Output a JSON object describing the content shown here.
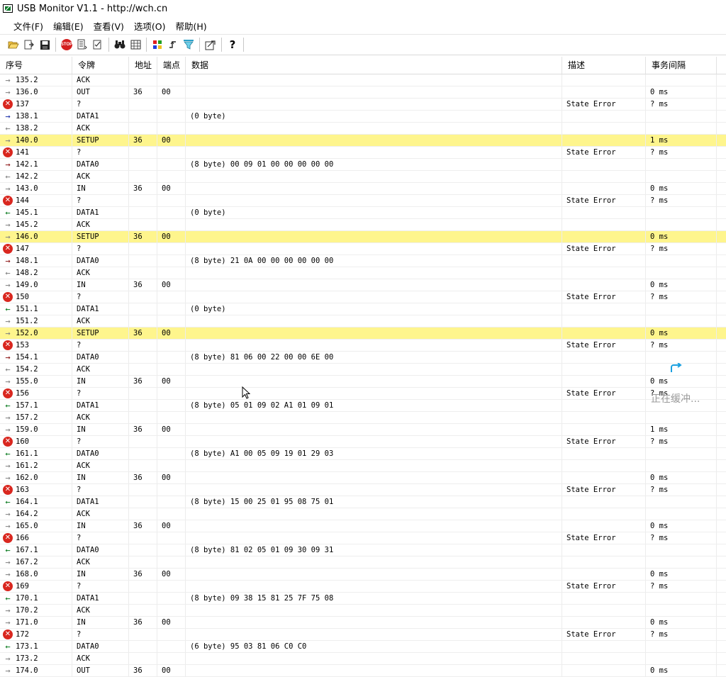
{
  "window": {
    "title": "USB Monitor V1.1 - http://wch.cn"
  },
  "menu": [
    "文件(F)",
    "编辑(E)",
    "查看(V)",
    "选项(O)",
    "帮助(H)"
  ],
  "toolbar": {
    "icons": [
      "open-folder-icon",
      "export-icon",
      "save-icon",
      "stop-icon",
      "filter-icon",
      "checklist-icon",
      "binoculars-find-icon",
      "grid-icon",
      "colors-icon",
      "trigger-icon",
      "funnel-icon",
      "settings-icon",
      "help-icon"
    ],
    "stop_text": "STOP",
    "help_text": "?"
  },
  "columns": [
    "序号",
    "令牌",
    "地址",
    "端点",
    "数据",
    "描述",
    "事务间隔"
  ],
  "rows": [
    {
      "seq": "135.2",
      "dir": "out",
      "token": "ACK",
      "addr": "",
      "ep": "",
      "data": "",
      "desc": "",
      "interval": ""
    },
    {
      "seq": "136.0",
      "dir": "out",
      "token": "OUT",
      "addr": "36",
      "ep": "00",
      "data": "",
      "desc": "",
      "interval": "0 ms"
    },
    {
      "seq": "137",
      "dir": "err",
      "token": "?",
      "addr": "",
      "ep": "",
      "data": "",
      "desc": "State Error",
      "interval": "? ms"
    },
    {
      "seq": "138.1",
      "dir": "host",
      "token": "DATA1",
      "addr": "",
      "ep": "",
      "data": "(0 byte)",
      "desc": "",
      "interval": ""
    },
    {
      "seq": "138.2",
      "dir": "in",
      "token": "ACK",
      "addr": "",
      "ep": "",
      "data": "",
      "desc": "",
      "interval": ""
    },
    {
      "seq": "140.0",
      "dir": "out",
      "token": "SETUP",
      "addr": "36",
      "ep": "00",
      "data": "",
      "desc": "",
      "interval": "1 ms",
      "hl": true
    },
    {
      "seq": "141",
      "dir": "err",
      "token": "?",
      "addr": "",
      "ep": "",
      "data": "",
      "desc": "State Error",
      "interval": "? ms"
    },
    {
      "seq": "142.1",
      "dir": "setup",
      "token": "DATA0",
      "addr": "",
      "ep": "",
      "data": "(8 byte) 00 09 01 00 00 00 00 00",
      "desc": "",
      "interval": ""
    },
    {
      "seq": "142.2",
      "dir": "in",
      "token": "ACK",
      "addr": "",
      "ep": "",
      "data": "",
      "desc": "",
      "interval": ""
    },
    {
      "seq": "143.0",
      "dir": "out",
      "token": "IN",
      "addr": "36",
      "ep": "00",
      "data": "",
      "desc": "",
      "interval": "0 ms"
    },
    {
      "seq": "144",
      "dir": "err",
      "token": "?",
      "addr": "",
      "ep": "",
      "data": "",
      "desc": "State Error",
      "interval": "? ms"
    },
    {
      "seq": "145.1",
      "dir": "dev",
      "token": "DATA1",
      "addr": "",
      "ep": "",
      "data": "(0 byte)",
      "desc": "",
      "interval": ""
    },
    {
      "seq": "145.2",
      "dir": "out",
      "token": "ACK",
      "addr": "",
      "ep": "",
      "data": "",
      "desc": "",
      "interval": ""
    },
    {
      "seq": "146.0",
      "dir": "out",
      "token": "SETUP",
      "addr": "36",
      "ep": "00",
      "data": "",
      "desc": "",
      "interval": "0 ms",
      "hl": true
    },
    {
      "seq": "147",
      "dir": "err",
      "token": "?",
      "addr": "",
      "ep": "",
      "data": "",
      "desc": "State Error",
      "interval": "? ms"
    },
    {
      "seq": "148.1",
      "dir": "setup",
      "token": "DATA0",
      "addr": "",
      "ep": "",
      "data": "(8 byte) 21 0A 00 00 00 00 00 00",
      "desc": "",
      "interval": ""
    },
    {
      "seq": "148.2",
      "dir": "in",
      "token": "ACK",
      "addr": "",
      "ep": "",
      "data": "",
      "desc": "",
      "interval": ""
    },
    {
      "seq": "149.0",
      "dir": "out",
      "token": "IN",
      "addr": "36",
      "ep": "00",
      "data": "",
      "desc": "",
      "interval": "0 ms"
    },
    {
      "seq": "150",
      "dir": "err",
      "token": "?",
      "addr": "",
      "ep": "",
      "data": "",
      "desc": "State Error",
      "interval": "? ms"
    },
    {
      "seq": "151.1",
      "dir": "dev",
      "token": "DATA1",
      "addr": "",
      "ep": "",
      "data": "(0 byte)",
      "desc": "",
      "interval": ""
    },
    {
      "seq": "151.2",
      "dir": "out",
      "token": "ACK",
      "addr": "",
      "ep": "",
      "data": "",
      "desc": "",
      "interval": ""
    },
    {
      "seq": "152.0",
      "dir": "out",
      "token": "SETUP",
      "addr": "36",
      "ep": "00",
      "data": "",
      "desc": "",
      "interval": "0 ms",
      "hl": true
    },
    {
      "seq": "153",
      "dir": "err",
      "token": "?",
      "addr": "",
      "ep": "",
      "data": "",
      "desc": "State Error",
      "interval": "? ms"
    },
    {
      "seq": "154.1",
      "dir": "setup",
      "token": "DATA0",
      "addr": "",
      "ep": "",
      "data": "(8 byte) 81 06 00 22 00 00 6E 00",
      "desc": "",
      "interval": ""
    },
    {
      "seq": "154.2",
      "dir": "in",
      "token": "ACK",
      "addr": "",
      "ep": "",
      "data": "",
      "desc": "",
      "interval": ""
    },
    {
      "seq": "155.0",
      "dir": "out",
      "token": "IN",
      "addr": "36",
      "ep": "00",
      "data": "",
      "desc": "",
      "interval": "0 ms"
    },
    {
      "seq": "156",
      "dir": "err",
      "token": "?",
      "addr": "",
      "ep": "",
      "data": "",
      "desc": "State Error",
      "interval": "? ms"
    },
    {
      "seq": "157.1",
      "dir": "dev",
      "token": "DATA1",
      "addr": "",
      "ep": "",
      "data": "(8 byte) 05 01 09 02 A1 01 09 01",
      "desc": "",
      "interval": ""
    },
    {
      "seq": "157.2",
      "dir": "out",
      "token": "ACK",
      "addr": "",
      "ep": "",
      "data": "",
      "desc": "",
      "interval": ""
    },
    {
      "seq": "159.0",
      "dir": "out",
      "token": "IN",
      "addr": "36",
      "ep": "00",
      "data": "",
      "desc": "",
      "interval": "1 ms"
    },
    {
      "seq": "160",
      "dir": "err",
      "token": "?",
      "addr": "",
      "ep": "",
      "data": "",
      "desc": "State Error",
      "interval": "? ms"
    },
    {
      "seq": "161.1",
      "dir": "dev",
      "token": "DATA0",
      "addr": "",
      "ep": "",
      "data": "(8 byte) A1 00 05 09 19 01 29 03",
      "desc": "",
      "interval": ""
    },
    {
      "seq": "161.2",
      "dir": "out",
      "token": "ACK",
      "addr": "",
      "ep": "",
      "data": "",
      "desc": "",
      "interval": ""
    },
    {
      "seq": "162.0",
      "dir": "out",
      "token": "IN",
      "addr": "36",
      "ep": "00",
      "data": "",
      "desc": "",
      "interval": "0 ms"
    },
    {
      "seq": "163",
      "dir": "err",
      "token": "?",
      "addr": "",
      "ep": "",
      "data": "",
      "desc": "State Error",
      "interval": "? ms"
    },
    {
      "seq": "164.1",
      "dir": "dev",
      "token": "DATA1",
      "addr": "",
      "ep": "",
      "data": "(8 byte) 15 00 25 01 95 08 75 01",
      "desc": "",
      "interval": ""
    },
    {
      "seq": "164.2",
      "dir": "out",
      "token": "ACK",
      "addr": "",
      "ep": "",
      "data": "",
      "desc": "",
      "interval": ""
    },
    {
      "seq": "165.0",
      "dir": "out",
      "token": "IN",
      "addr": "36",
      "ep": "00",
      "data": "",
      "desc": "",
      "interval": "0 ms"
    },
    {
      "seq": "166",
      "dir": "err",
      "token": "?",
      "addr": "",
      "ep": "",
      "data": "",
      "desc": "State Error",
      "interval": "? ms"
    },
    {
      "seq": "167.1",
      "dir": "dev",
      "token": "DATA0",
      "addr": "",
      "ep": "",
      "data": "(8 byte) 81 02 05 01 09 30 09 31",
      "desc": "",
      "interval": ""
    },
    {
      "seq": "167.2",
      "dir": "out",
      "token": "ACK",
      "addr": "",
      "ep": "",
      "data": "",
      "desc": "",
      "interval": ""
    },
    {
      "seq": "168.0",
      "dir": "out",
      "token": "IN",
      "addr": "36",
      "ep": "00",
      "data": "",
      "desc": "",
      "interval": "0 ms"
    },
    {
      "seq": "169",
      "dir": "err",
      "token": "?",
      "addr": "",
      "ep": "",
      "data": "",
      "desc": "State Error",
      "interval": "? ms"
    },
    {
      "seq": "170.1",
      "dir": "dev",
      "token": "DATA1",
      "addr": "",
      "ep": "",
      "data": "(8 byte) 09 38 15 81 25 7F 75 08",
      "desc": "",
      "interval": ""
    },
    {
      "seq": "170.2",
      "dir": "out",
      "token": "ACK",
      "addr": "",
      "ep": "",
      "data": "",
      "desc": "",
      "interval": ""
    },
    {
      "seq": "171.0",
      "dir": "out",
      "token": "IN",
      "addr": "36",
      "ep": "00",
      "data": "",
      "desc": "",
      "interval": "0 ms"
    },
    {
      "seq": "172",
      "dir": "err",
      "token": "?",
      "addr": "",
      "ep": "",
      "data": "",
      "desc": "State Error",
      "interval": "? ms"
    },
    {
      "seq": "173.1",
      "dir": "dev",
      "token": "DATA0",
      "addr": "",
      "ep": "",
      "data": "(6 byte) 95 03 81 06 C0 C0",
      "desc": "",
      "interval": ""
    },
    {
      "seq": "173.2",
      "dir": "out",
      "token": "ACK",
      "addr": "",
      "ep": "",
      "data": "",
      "desc": "",
      "interval": ""
    },
    {
      "seq": "174.0",
      "dir": "out",
      "token": "OUT",
      "addr": "36",
      "ep": "00",
      "data": "",
      "desc": "",
      "interval": "0 ms"
    }
  ],
  "overlay": {
    "buffering_text": "正在缓冲...",
    "icon": "loading-spinner-icon"
  },
  "colors": {
    "highlight": "#fef58d",
    "error": "#d9271f",
    "host_arrow": "#1a2ea8",
    "setup_arrow": "#8b1010",
    "device_arrow": "#0a7a1f"
  }
}
